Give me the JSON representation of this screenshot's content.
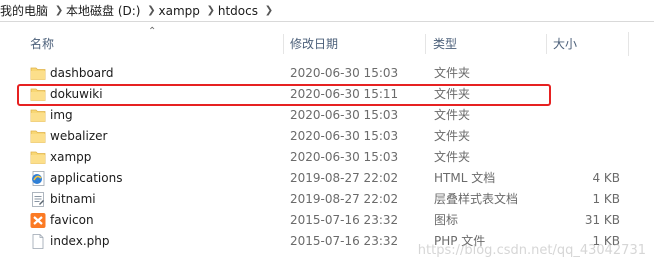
{
  "breadcrumb": [
    "我的电脑",
    "本地磁盘 (D:)",
    "xampp",
    "htdocs"
  ],
  "columns": {
    "name": "名称",
    "date": "修改日期",
    "type": "类型",
    "size": "大小"
  },
  "files": [
    {
      "name": "dashboard",
      "date": "2020-06-30 15:03",
      "type": "文件夹",
      "size": "",
      "icon": "folder-icon"
    },
    {
      "name": "dokuwiki",
      "date": "2020-06-30 15:11",
      "type": "文件夹",
      "size": "",
      "icon": "folder-icon"
    },
    {
      "name": "img",
      "date": "2020-06-30 15:03",
      "type": "文件夹",
      "size": "",
      "icon": "folder-icon"
    },
    {
      "name": "webalizer",
      "date": "2020-06-30 15:03",
      "type": "文件夹",
      "size": "",
      "icon": "folder-icon"
    },
    {
      "name": "xampp",
      "date": "2020-06-30 15:03",
      "type": "文件夹",
      "size": "",
      "icon": "folder-icon"
    },
    {
      "name": "applications",
      "date": "2019-08-27 22:02",
      "type": "HTML 文档",
      "size": "4 KB",
      "icon": "html-document-icon"
    },
    {
      "name": "bitnami",
      "date": "2019-08-27 22:02",
      "type": "层叠样式表文档",
      "size": "1 KB",
      "icon": "css-document-icon"
    },
    {
      "name": "favicon",
      "date": "2015-07-16 23:32",
      "type": "图标",
      "size": "31 KB",
      "icon": "xampp-icon"
    },
    {
      "name": "index.php",
      "date": "2015-07-16 23:32",
      "type": "PHP 文件",
      "size": "1 KB",
      "icon": "file-icon"
    }
  ],
  "highlighted_row": "dokuwiki",
  "watermark": "https://blog.csdn.net/qq_43042731"
}
